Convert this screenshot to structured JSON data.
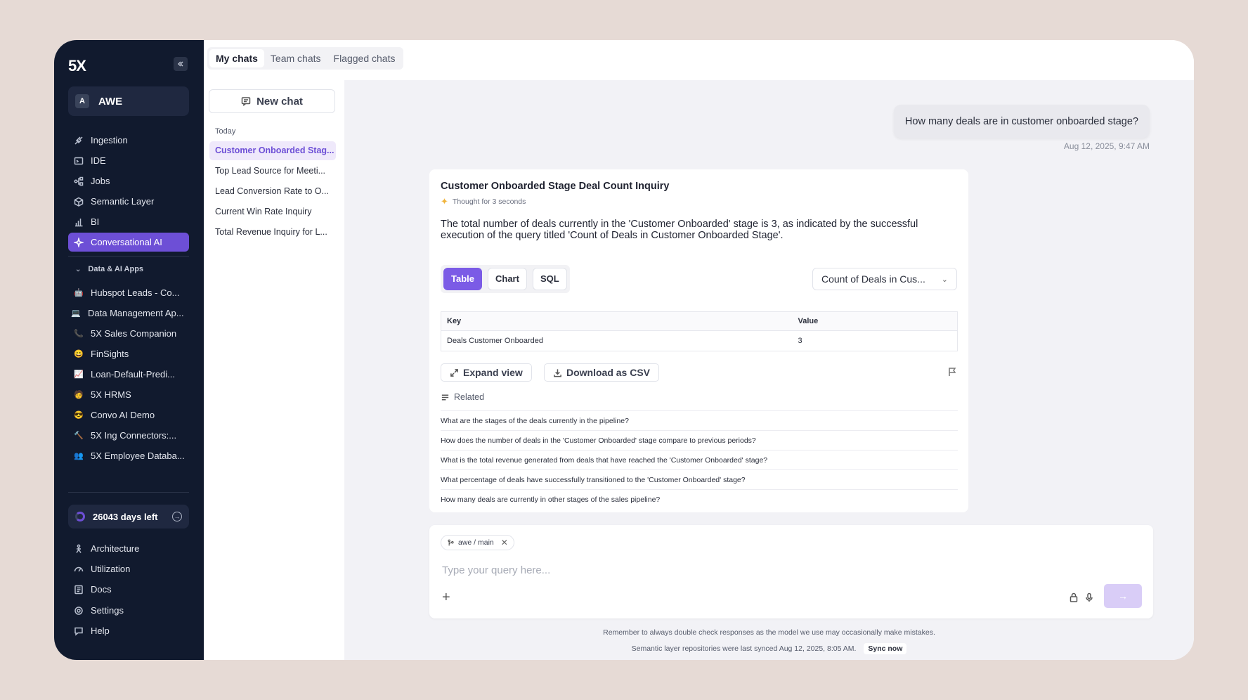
{
  "sidebar": {
    "logo": "5X",
    "workspace": {
      "initial": "A",
      "name": "AWE"
    },
    "nav": [
      {
        "label": "Ingestion",
        "icon": "plug-icon"
      },
      {
        "label": "IDE",
        "icon": "terminal-icon"
      },
      {
        "label": "Jobs",
        "icon": "workflow-icon"
      },
      {
        "label": "Semantic Layer",
        "icon": "cube-icon"
      },
      {
        "label": "BI",
        "icon": "bar-chart-icon"
      },
      {
        "label": "Conversational AI",
        "icon": "sparkle-icon",
        "active": true
      }
    ],
    "apps_section": "Data & AI Apps",
    "apps": [
      {
        "label": "Hubspot Leads - Co...",
        "emoji": "🤖"
      },
      {
        "label": "Data Management Ap...",
        "emoji": "💻"
      },
      {
        "label": "5X Sales Companion",
        "emoji": "📞"
      },
      {
        "label": "FinSights",
        "emoji": "😀"
      },
      {
        "label": "Loan-Default-Predi...",
        "emoji": "📈"
      },
      {
        "label": "5X HRMS",
        "emoji": "🧑"
      },
      {
        "label": "Convo AI Demo",
        "emoji": "😎"
      },
      {
        "label": "5X Ing Connectors:...",
        "emoji": "🔨"
      },
      {
        "label": "5X Employee Databa...",
        "emoji": "👥"
      }
    ],
    "days_left": "26043 days left",
    "bottom": [
      {
        "label": "Architecture",
        "icon": "person-icon"
      },
      {
        "label": "Utilization",
        "icon": "gauge-icon"
      },
      {
        "label": "Docs",
        "icon": "doc-icon"
      },
      {
        "label": "Settings",
        "icon": "gear-icon"
      },
      {
        "label": "Help",
        "icon": "chat-icon"
      }
    ]
  },
  "tabs": [
    "My chats",
    "Team chats",
    "Flagged chats"
  ],
  "chats": {
    "new_chat": "New chat",
    "group": "Today",
    "items": [
      "Customer Onboarded Stag...",
      "Top Lead Source for Meeti...",
      "Lead Conversion Rate to O...",
      "Current Win Rate Inquiry",
      "Total Revenue Inquiry for L..."
    ]
  },
  "conversation": {
    "user_message": "How many deals are in customer onboarded stage?",
    "user_time": "Aug 12, 2025, 9:47 AM",
    "answer_title": "Customer Onboarded Stage Deal Count Inquiry",
    "thought": "Thought for 3 seconds",
    "answer_text": "The total number of deals currently in the 'Customer Onboarded' stage is 3, as indicated by the successful execution of the query titled 'Count of Deals in Customer Onboarded Stage'.",
    "view_tabs": [
      "Table",
      "Chart",
      "SQL"
    ],
    "query_select": "Count of Deals in Cus...",
    "table": {
      "headers": [
        "Key",
        "Value"
      ],
      "rows": [
        [
          "Deals Customer Onboarded",
          "3"
        ]
      ]
    },
    "expand_label": "Expand view",
    "download_label": "Download as CSV",
    "related_label": "Related",
    "related": [
      "What are the stages of the deals currently in the pipeline?",
      "How does the number of deals in the 'Customer Onboarded' stage compare to previous periods?",
      "What is the total revenue generated from deals that have reached the 'Customer Onboarded' stage?",
      "What percentage of deals have successfully transitioned to the 'Customer Onboarded' stage?",
      "How many deals are currently in other stages of the sales pipeline?"
    ]
  },
  "composer": {
    "branch": "awe / main",
    "placeholder": "Type your query here..."
  },
  "footer": {
    "disclaimer": "Remember to always double check responses as the model we use may occasionally make mistakes.",
    "synced": "Semantic layer repositories were last synced Aug 12, 2025, 8:05 AM.",
    "sync_now": "Sync now"
  },
  "colors": {
    "accent": "#6d4fd6",
    "sidebar_bg": "#111a2e"
  }
}
